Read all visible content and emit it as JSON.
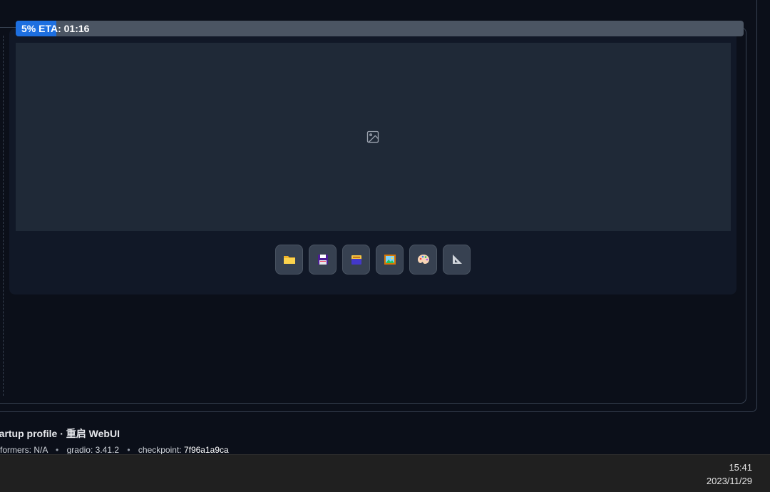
{
  "progress": {
    "percent": 5,
    "text": "5% ETA: 01:16"
  },
  "gallery": {
    "placeholder_icon": "image-icon"
  },
  "toolbar": {
    "buttons": [
      {
        "name": "open-folder-button",
        "icon": "folder-icon"
      },
      {
        "name": "save-button",
        "icon": "floppy-disk-icon"
      },
      {
        "name": "zip-button",
        "icon": "card-index-icon"
      },
      {
        "name": "send-to-img2img-button",
        "icon": "framed-picture-icon"
      },
      {
        "name": "send-to-inpaint-button",
        "icon": "artist-palette-icon"
      },
      {
        "name": "send-to-extras-button",
        "icon": "triangular-ruler-icon"
      }
    ]
  },
  "footer": {
    "title": "tartup profile · 重启 WebUI",
    "xformers_label": "xformers:",
    "xformers_value": "N/A",
    "gradio_label": "gradio:",
    "gradio_value": "3.41.2",
    "checkpoint_label": "checkpoint:",
    "checkpoint_value": "7f96a1a9ca"
  },
  "taskbar": {
    "time": "15:41",
    "date": "2023/11/29"
  },
  "colors": {
    "background": "#0b0f19",
    "panel": "#111827",
    "preview": "#1f2937",
    "progress_fill": "#1d6fe0",
    "progress_track": "#4b5563"
  }
}
